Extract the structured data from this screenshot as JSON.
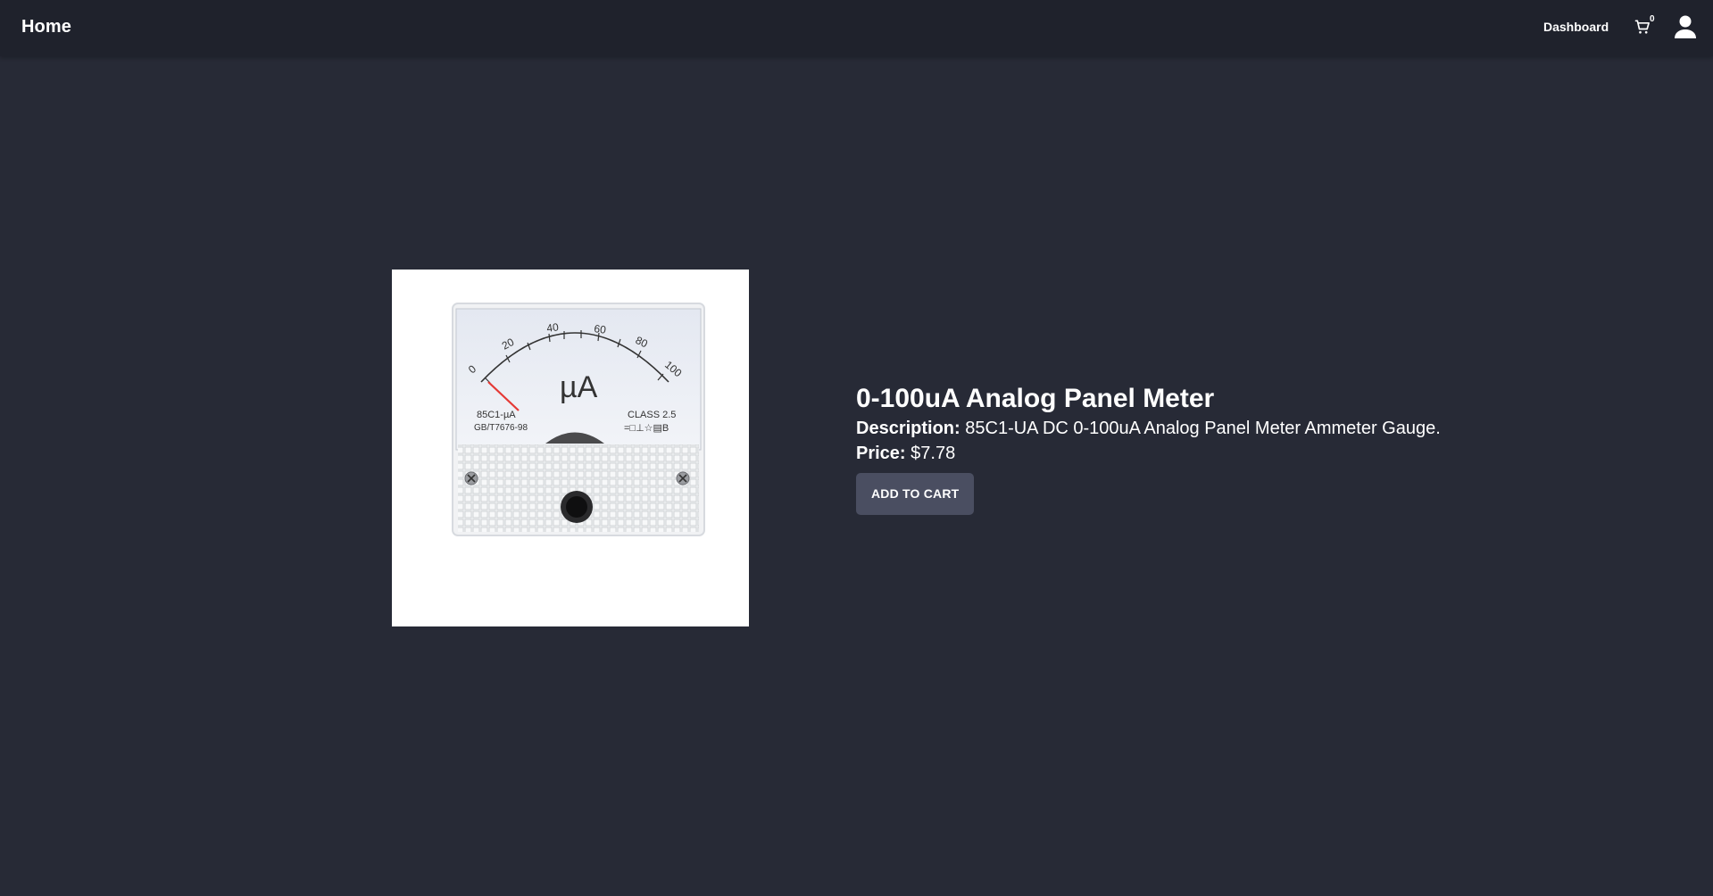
{
  "nav": {
    "home_label": "Home",
    "dashboard_label": "Dashboard",
    "cart_count": "0",
    "cart_icon": "shopping-cart-icon",
    "user_icon": "user-account-icon"
  },
  "product": {
    "title": "0-100uA Analog Panel Meter",
    "description_label": "Description:",
    "description": "85C1-UA DC 0-100uA Analog Panel Meter Ammeter Gauge.",
    "price_label": "Price:",
    "price": "$7.78",
    "add_to_cart_label": "ADD TO CART",
    "image_alt": "0-100uA Analog Panel Meter",
    "meter": {
      "unit": "µA",
      "scale_ticks": [
        "0",
        "20",
        "40",
        "60",
        "80",
        "100"
      ],
      "model_text": "85C1-µA",
      "standard_text": "GB/T7676-98",
      "class_text": "CLASS 2.5",
      "symbols_text": "=□⊥☆▤B"
    }
  },
  "colors": {
    "background": "#272a36",
    "appbar": "#1f222c",
    "button": "#4a4e61",
    "needle": "#e53935"
  }
}
